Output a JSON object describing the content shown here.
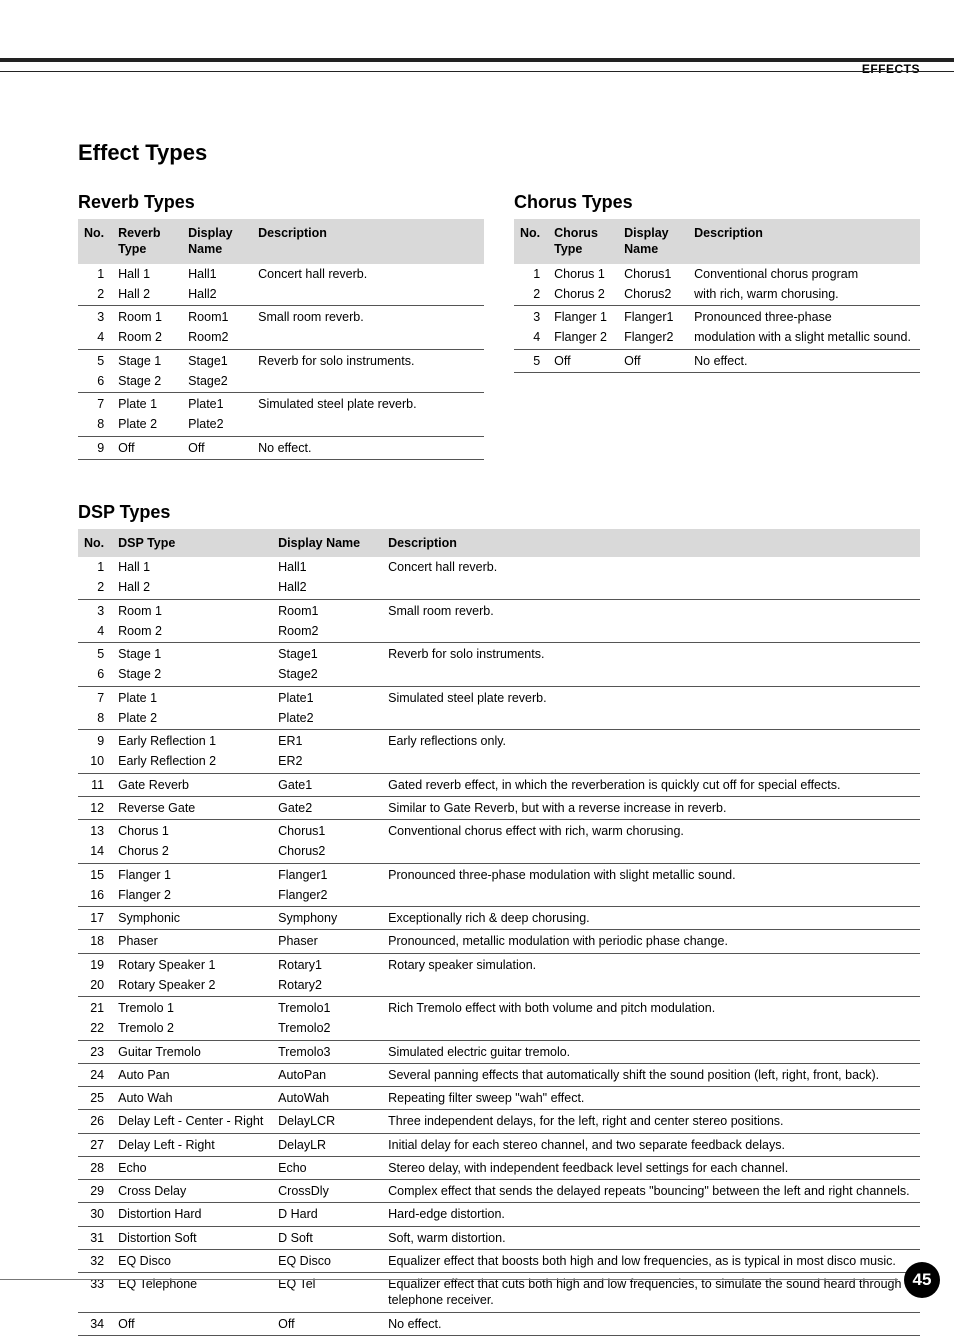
{
  "header": {
    "section": "EFFECTS",
    "title": "Effect Types"
  },
  "page_number": "45",
  "reverb": {
    "title": "Reverb Types",
    "columns": [
      "No.",
      "Reverb Type",
      "Display Name",
      "Description"
    ],
    "groups": [
      {
        "rows": [
          {
            "no": "1",
            "type": "Hall 1",
            "disp": "Hall1",
            "desc": "Concert hall reverb."
          },
          {
            "no": "2",
            "type": "Hall 2",
            "disp": "Hall2",
            "desc": ""
          }
        ]
      },
      {
        "rows": [
          {
            "no": "3",
            "type": "Room 1",
            "disp": "Room1",
            "desc": "Small room reverb."
          },
          {
            "no": "4",
            "type": "Room 2",
            "disp": "Room2",
            "desc": ""
          }
        ]
      },
      {
        "rows": [
          {
            "no": "5",
            "type": "Stage 1",
            "disp": "Stage1",
            "desc": "Reverb for solo instruments."
          },
          {
            "no": "6",
            "type": "Stage 2",
            "disp": "Stage2",
            "desc": ""
          }
        ]
      },
      {
        "rows": [
          {
            "no": "7",
            "type": "Plate 1",
            "disp": "Plate1",
            "desc": "Simulated steel plate reverb."
          },
          {
            "no": "8",
            "type": "Plate 2",
            "disp": "Plate2",
            "desc": ""
          }
        ]
      },
      {
        "rows": [
          {
            "no": "9",
            "type": "Off",
            "disp": "Off",
            "desc": "No effect."
          }
        ]
      }
    ]
  },
  "chorus": {
    "title": "Chorus Types",
    "columns": [
      "No.",
      "Chorus Type",
      "Display Name",
      "Description"
    ],
    "groups": [
      {
        "rows": [
          {
            "no": "1",
            "type": "Chorus 1",
            "disp": "Chorus1",
            "desc": "Conventional chorus program"
          },
          {
            "no": "2",
            "type": "Chorus 2",
            "disp": "Chorus2",
            "desc": "with rich, warm chorusing."
          }
        ]
      },
      {
        "rows": [
          {
            "no": "3",
            "type": "Flanger 1",
            "disp": "Flanger1",
            "desc": "Pronounced three-phase"
          },
          {
            "no": "4",
            "type": "Flanger 2",
            "disp": "Flanger2",
            "desc": "modulation with a slight metallic sound."
          }
        ]
      },
      {
        "rows": [
          {
            "no": "5",
            "type": "Off",
            "disp": "Off",
            "desc": "No effect."
          }
        ]
      }
    ]
  },
  "dsp": {
    "title": "DSP Types",
    "columns": [
      "No.",
      "DSP Type",
      "Display Name",
      "Description"
    ],
    "groups": [
      {
        "rows": [
          {
            "no": "1",
            "type": "Hall 1",
            "disp": "Hall1",
            "desc": "Concert hall reverb."
          },
          {
            "no": "2",
            "type": "Hall 2",
            "disp": "Hall2",
            "desc": ""
          }
        ]
      },
      {
        "rows": [
          {
            "no": "3",
            "type": "Room 1",
            "disp": "Room1",
            "desc": "Small room reverb."
          },
          {
            "no": "4",
            "type": "Room 2",
            "disp": "Room2",
            "desc": ""
          }
        ]
      },
      {
        "rows": [
          {
            "no": "5",
            "type": "Stage 1",
            "disp": "Stage1",
            "desc": "Reverb for solo instruments."
          },
          {
            "no": "6",
            "type": "Stage 2",
            "disp": "Stage2",
            "desc": ""
          }
        ]
      },
      {
        "rows": [
          {
            "no": "7",
            "type": "Plate 1",
            "disp": "Plate1",
            "desc": "Simulated steel plate reverb."
          },
          {
            "no": "8",
            "type": "Plate 2",
            "disp": "Plate2",
            "desc": ""
          }
        ]
      },
      {
        "rows": [
          {
            "no": "9",
            "type": "Early Reflection 1",
            "disp": "ER1",
            "desc": "Early reflections only."
          },
          {
            "no": "10",
            "type": "Early Reflection 2",
            "disp": "ER2",
            "desc": ""
          }
        ]
      },
      {
        "rows": [
          {
            "no": "11",
            "type": "Gate Reverb",
            "disp": "Gate1",
            "desc": "Gated reverb effect, in which the reverberation is quickly cut off for special effects."
          }
        ]
      },
      {
        "rows": [
          {
            "no": "12",
            "type": "Reverse Gate",
            "disp": "Gate2",
            "desc": "Similar to Gate Reverb, but with a reverse increase in reverb."
          }
        ]
      },
      {
        "rows": [
          {
            "no": "13",
            "type": "Chorus 1",
            "disp": "Chorus1",
            "desc": "Conventional chorus effect with rich, warm chorusing."
          },
          {
            "no": "14",
            "type": "Chorus 2",
            "disp": "Chorus2",
            "desc": ""
          }
        ]
      },
      {
        "rows": [
          {
            "no": "15",
            "type": "Flanger 1",
            "disp": "Flanger1",
            "desc": "Pronounced three-phase modulation with slight metallic sound."
          },
          {
            "no": "16",
            "type": "Flanger 2",
            "disp": "Flanger2",
            "desc": ""
          }
        ]
      },
      {
        "rows": [
          {
            "no": "17",
            "type": "Symphonic",
            "disp": "Symphony",
            "desc": "Exceptionally rich & deep chorusing."
          }
        ]
      },
      {
        "rows": [
          {
            "no": "18",
            "type": "Phaser",
            "disp": "Phaser",
            "desc": "Pronounced, metallic modulation with periodic phase change."
          }
        ]
      },
      {
        "rows": [
          {
            "no": "19",
            "type": "Rotary Speaker 1",
            "disp": "Rotary1",
            "desc": "Rotary speaker simulation."
          },
          {
            "no": "20",
            "type": "Rotary Speaker 2",
            "disp": "Rotary2",
            "desc": ""
          }
        ]
      },
      {
        "rows": [
          {
            "no": "21",
            "type": "Tremolo 1",
            "disp": "Tremolo1",
            "desc": "Rich Tremolo effect with both volume and pitch modulation."
          },
          {
            "no": "22",
            "type": "Tremolo 2",
            "disp": "Tremolo2",
            "desc": ""
          }
        ]
      },
      {
        "rows": [
          {
            "no": "23",
            "type": "Guitar Tremolo",
            "disp": "Tremolo3",
            "desc": "Simulated electric guitar tremolo."
          }
        ]
      },
      {
        "rows": [
          {
            "no": "24",
            "type": "Auto Pan",
            "disp": "AutoPan",
            "desc": "Several panning effects that automatically shift the sound position (left, right, front, back)."
          }
        ]
      },
      {
        "rows": [
          {
            "no": "25",
            "type": "Auto Wah",
            "disp": "AutoWah",
            "desc": "Repeating filter sweep \"wah\" effect."
          }
        ]
      },
      {
        "rows": [
          {
            "no": "26",
            "type": "Delay Left - Center - Right",
            "disp": "DelayLCR",
            "desc": "Three independent delays, for the left, right and center stereo positions."
          }
        ]
      },
      {
        "rows": [
          {
            "no": "27",
            "type": "Delay Left - Right",
            "disp": "DelayLR",
            "desc": "Initial delay for each stereo channel, and two separate feedback delays."
          }
        ]
      },
      {
        "rows": [
          {
            "no": "28",
            "type": "Echo",
            "disp": "Echo",
            "desc": "Stereo delay, with independent feedback level settings for each channel."
          }
        ]
      },
      {
        "rows": [
          {
            "no": "29",
            "type": "Cross Delay",
            "disp": "CrossDly",
            "desc": "Complex effect that sends the delayed repeats \"bouncing\" between the left and right channels."
          }
        ]
      },
      {
        "rows": [
          {
            "no": "30",
            "type": "Distortion Hard",
            "disp": "D Hard",
            "desc": "Hard-edge distortion."
          }
        ]
      },
      {
        "rows": [
          {
            "no": "31",
            "type": "Distortion Soft",
            "disp": "D Soft",
            "desc": "Soft, warm distortion."
          }
        ]
      },
      {
        "rows": [
          {
            "no": "32",
            "type": "EQ Disco",
            "disp": "EQ Disco",
            "desc": "Equalizer effect that boosts both high and low frequencies, as is typical in most disco music."
          }
        ]
      },
      {
        "rows": [
          {
            "no": "33",
            "type": "EQ Telephone",
            "disp": "EQ Tel",
            "desc": "Equalizer effect that cuts both high and low frequencies, to simulate the sound heard through a telephone receiver."
          }
        ]
      },
      {
        "rows": [
          {
            "no": "34",
            "type": "Off",
            "disp": "Off",
            "desc": "No effect."
          }
        ]
      }
    ]
  }
}
